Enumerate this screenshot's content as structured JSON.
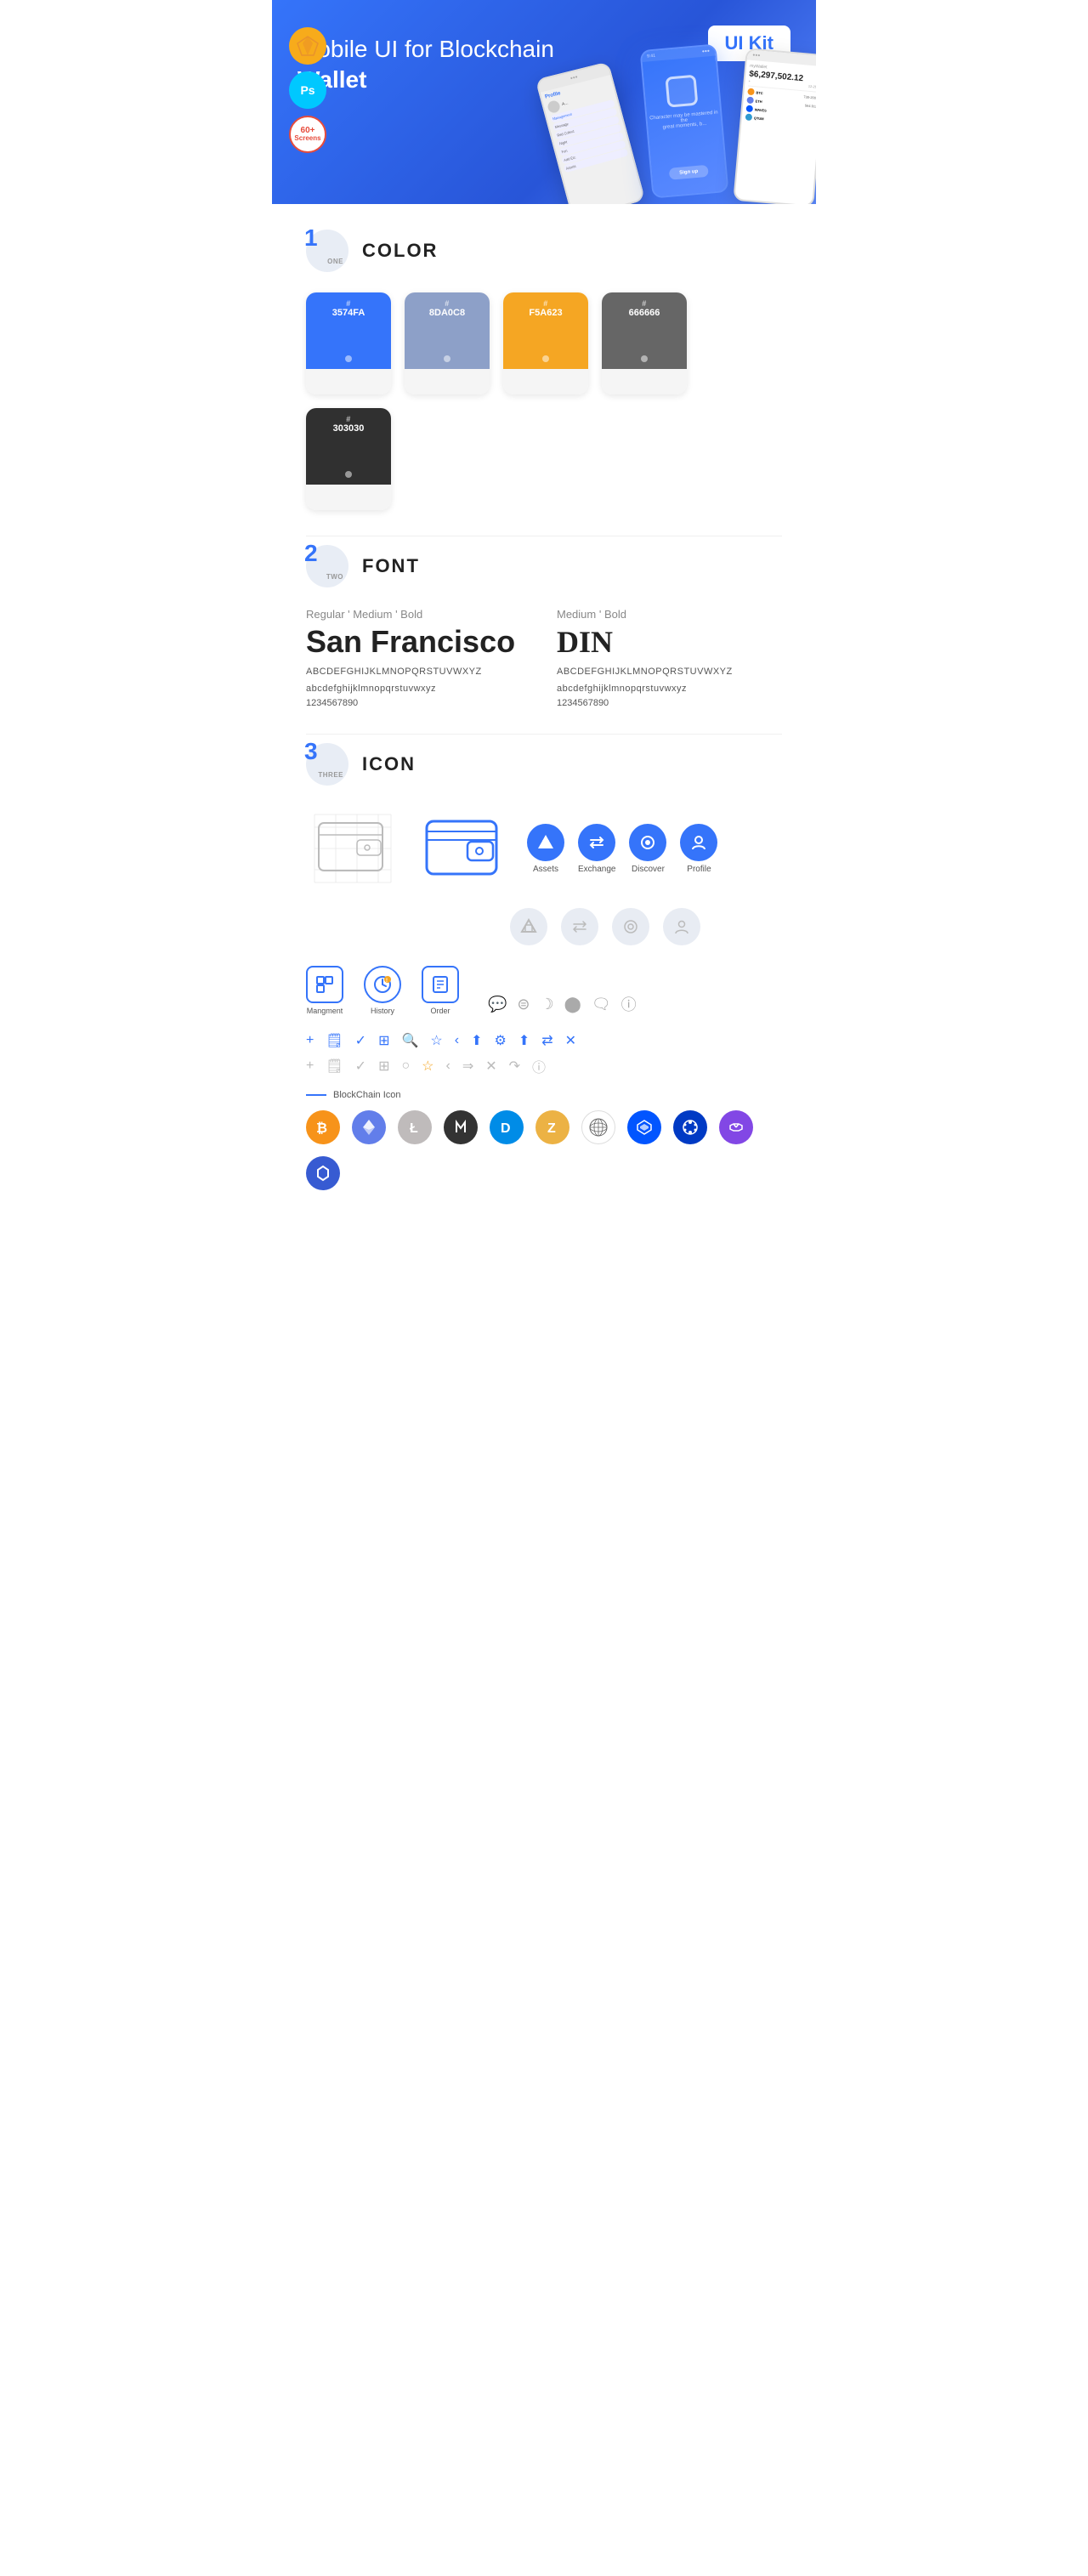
{
  "hero": {
    "title": "Mobile UI for Blockchain ",
    "title_bold": "Wallet",
    "badge": "UI Kit",
    "badges": [
      {
        "type": "sketch",
        "label": "S"
      },
      {
        "type": "ps",
        "label": "Ps"
      },
      {
        "type": "screens",
        "line1": "60+",
        "line2": "Screens"
      }
    ]
  },
  "sections": {
    "color": {
      "number": "1",
      "number_label": "ONE",
      "title": "COLOR",
      "swatches": [
        {
          "hex": "#",
          "value": "3574FA",
          "color": "#3574FA"
        },
        {
          "hex": "#",
          "value": "8DA0C8",
          "color": "#8DA0C8"
        },
        {
          "hex": "#",
          "value": "F5A623",
          "color": "#F5A623"
        },
        {
          "hex": "#",
          "value": "666666",
          "color": "#666666"
        },
        {
          "hex": "#",
          "value": "303030",
          "color": "#303030"
        }
      ]
    },
    "font": {
      "number": "2",
      "number_label": "TWO",
      "title": "FONT",
      "fonts": [
        {
          "style": "Regular ' Medium ' Bold",
          "name": "San Francisco",
          "upper": "ABCDEFGHIJKLMNOPQRSTUVWXYZ",
          "lower": "abcdefghijklmnopqrstuvwxyz",
          "nums": "1234567890"
        },
        {
          "style": "Medium ' Bold",
          "name": "DIN",
          "upper": "ABCDEFGHIJKLMNOPQRSTUVWXYZ",
          "lower": "abcdefghijklmnopqrstuvwxyz",
          "nums": "1234567890"
        }
      ]
    },
    "icon": {
      "number": "3",
      "number_label": "THREE",
      "title": "ICON",
      "nav_icons": [
        {
          "label": "Assets",
          "active": true
        },
        {
          "label": "Exchange",
          "active": true
        },
        {
          "label": "Discover",
          "active": true
        },
        {
          "label": "Profile",
          "active": true
        }
      ],
      "mgmt_icons": [
        {
          "label": "Mangment"
        },
        {
          "label": "History"
        },
        {
          "label": "Order"
        }
      ],
      "blockchain_label": "BlockChain Icon",
      "crypto_icons": [
        {
          "name": "bitcoin",
          "color": "#F7931A",
          "symbol": "₿"
        },
        {
          "name": "ethereum",
          "color": "#627EEA",
          "symbol": "Ξ"
        },
        {
          "name": "litecoin",
          "color": "#BFBBBB",
          "symbol": "Ł"
        },
        {
          "name": "neo",
          "color": "#58BF00",
          "symbol": "N"
        },
        {
          "name": "dash",
          "color": "#008CE7",
          "symbol": "D"
        },
        {
          "name": "zcash",
          "color": "#ECB244",
          "symbol": "Z"
        },
        {
          "name": "qtum",
          "color": "#2E9AD0",
          "symbol": "Q"
        },
        {
          "name": "waves",
          "color": "#0155FF",
          "symbol": "W"
        },
        {
          "name": "cardano",
          "color": "#003AC4",
          "symbol": "A"
        },
        {
          "name": "polygon",
          "color": "#8247E5",
          "symbol": "P"
        },
        {
          "name": "chainlink",
          "color": "#375BD2",
          "symbol": "⬡"
        }
      ]
    }
  }
}
